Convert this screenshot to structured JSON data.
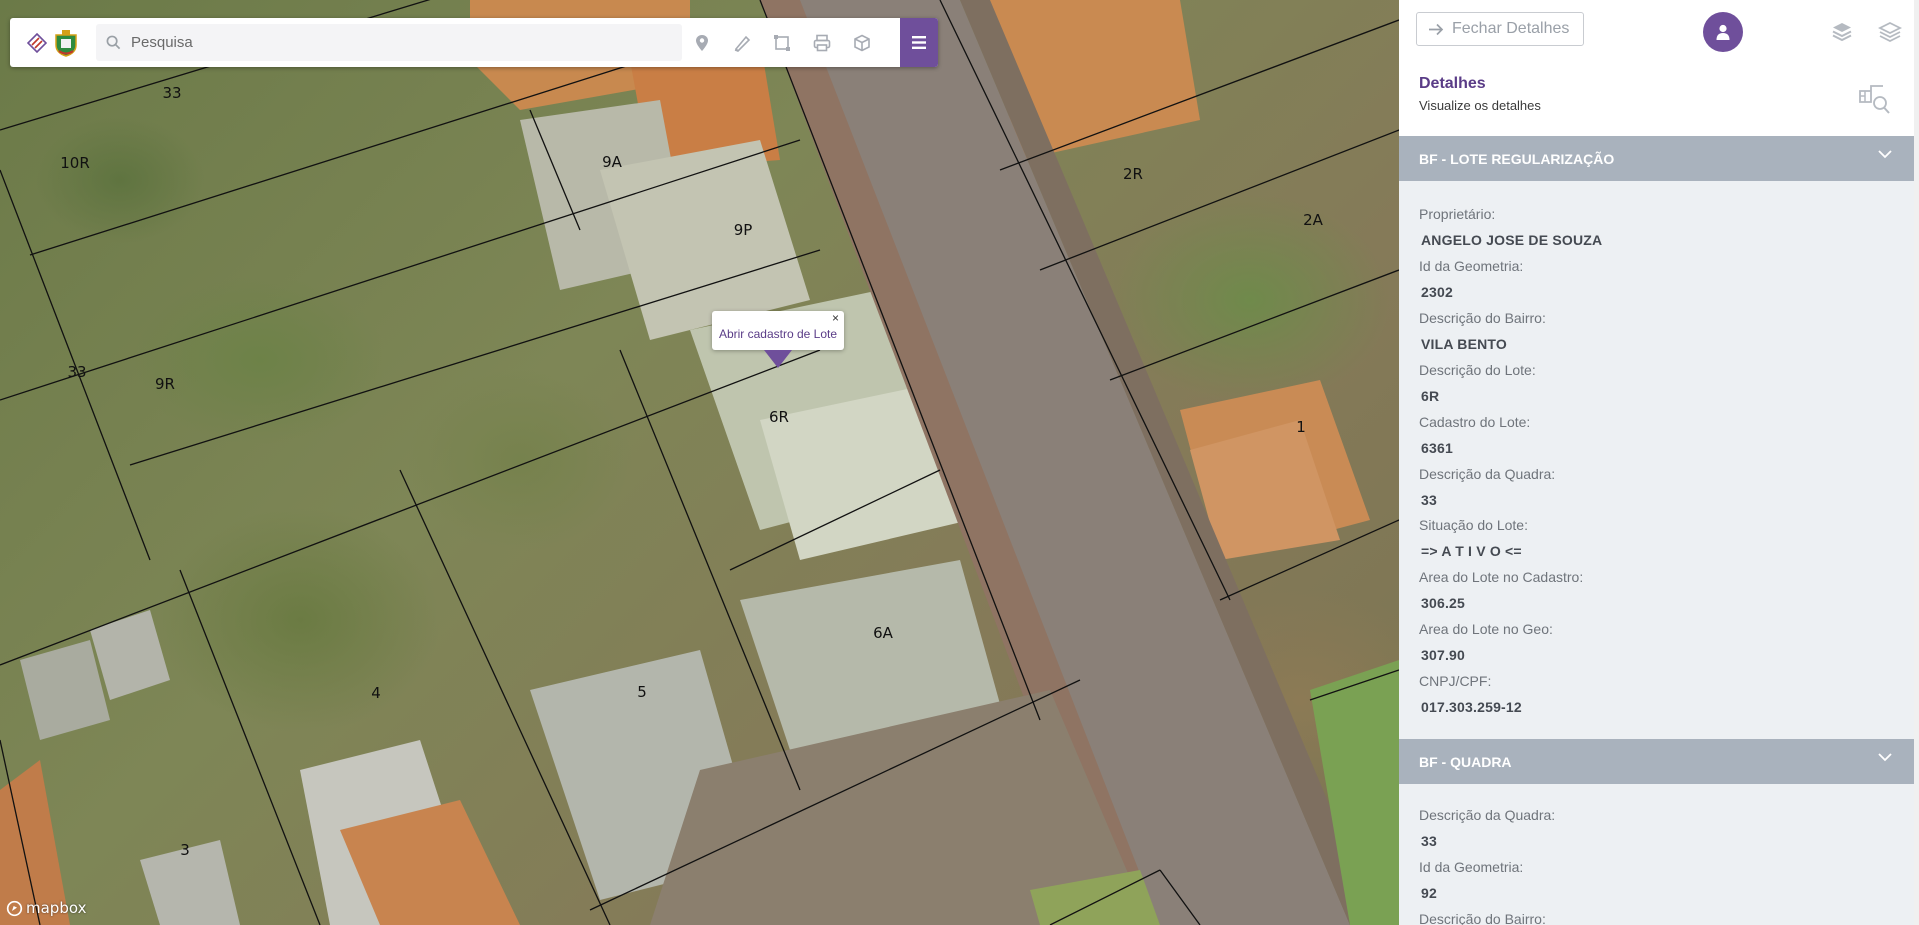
{
  "search": {
    "placeholder": "Pesquisa"
  },
  "map": {
    "lot_labels": [
      "33",
      "10R",
      "9A",
      "9P",
      "2R",
      "2A",
      "33",
      "9R",
      "6R",
      "1",
      "6A",
      "4",
      "5",
      "3"
    ],
    "popup": {
      "text": "Abrir cadastro de Lote",
      "close": "×"
    },
    "attribution": "mapbox"
  },
  "toolbar": {
    "tools": [
      "marker-icon",
      "ruler-icon",
      "area-icon",
      "print-icon",
      "cube-icon"
    ],
    "menu_icon": "hamburger-icon"
  },
  "panel": {
    "close_label": "Fechar Detalhes",
    "title": "Detalhes",
    "subtitle": "Visualize os detalhes",
    "sections": [
      {
        "title": "BF - LOTE REGULARIZAÇÃO",
        "fields": [
          {
            "label": "Proprietário:",
            "value": "ANGELO JOSE DE SOUZA"
          },
          {
            "label": "Id da Geometria:",
            "value": "2302"
          },
          {
            "label": "Descrição do Bairro:",
            "value": "VILA BENTO"
          },
          {
            "label": "Descrição do Lote:",
            "value": "6R"
          },
          {
            "label": "Cadastro do Lote:",
            "value": "6361"
          },
          {
            "label": "Descrição da Quadra:",
            "value": "33"
          },
          {
            "label": "Situação do Lote:",
            "value": "=> A T I V O <="
          },
          {
            "label": "Area do Lote no Cadastro:",
            "value": "306.25"
          },
          {
            "label": "Area do Lote no Geo:",
            "value": "307.90"
          },
          {
            "label": "CNPJ/CPF:",
            "value": "017.303.259-12"
          }
        ]
      },
      {
        "title": "BF - QUADRA",
        "fields": [
          {
            "label": "Descrição da Quadra:",
            "value": "33"
          },
          {
            "label": "Id da Geometria:",
            "value": "92"
          },
          {
            "label": "Descrição do Bairro:",
            "value": ""
          }
        ]
      }
    ]
  },
  "colors": {
    "accent": "#6f4f9b",
    "section_bar": "#a9b2bd",
    "section_body": "#edf0f3"
  }
}
